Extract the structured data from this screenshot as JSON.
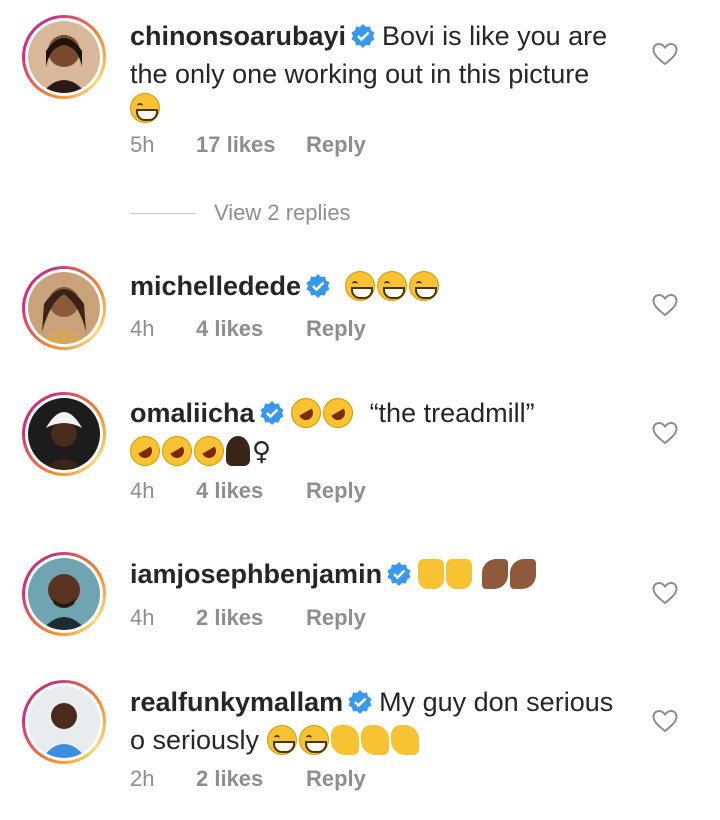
{
  "comments": [
    {
      "username": "chinonsoarubayi",
      "text_line1": "Bovi is like you are",
      "text_line2": "the only one working out in this picture",
      "time": "5h",
      "likes": "17 likes",
      "reply": "Reply"
    },
    {
      "username": "michelledede",
      "time": "4h",
      "likes": "4 likes",
      "reply": "Reply"
    },
    {
      "username": "omaliicha",
      "text_quote": "“the treadmill”",
      "female_sign": "♀",
      "time": "4h",
      "likes": "4 likes",
      "reply": "Reply"
    },
    {
      "username": "iamjosephbenjamin",
      "time": "4h",
      "likes": "2 likes",
      "reply": "Reply"
    },
    {
      "username": "realfunkymallam",
      "text_line1": "My guy don serious",
      "text_line2": "o seriously",
      "time": "2h",
      "likes": "2 likes",
      "reply": "Reply"
    }
  ],
  "view_replies": "View 2 replies",
  "icons": {
    "verified": "verified-badge-icon",
    "like": "heart-outline-icon",
    "emoji_grin": "grinning-face-emoji",
    "emoji_rofl": "rolling-on-floor-laughing-emoji",
    "emoji_raise": "raising-hands-emoji",
    "emoji_muscle": "flexed-biceps-emoji",
    "emoji_clap": "clapping-hands-emoji",
    "emoji_person": "person-facepalming-emoji"
  },
  "colors": {
    "verified_blue": "#3897f0",
    "meta_gray": "#8e8e8e",
    "text": "#262626"
  }
}
